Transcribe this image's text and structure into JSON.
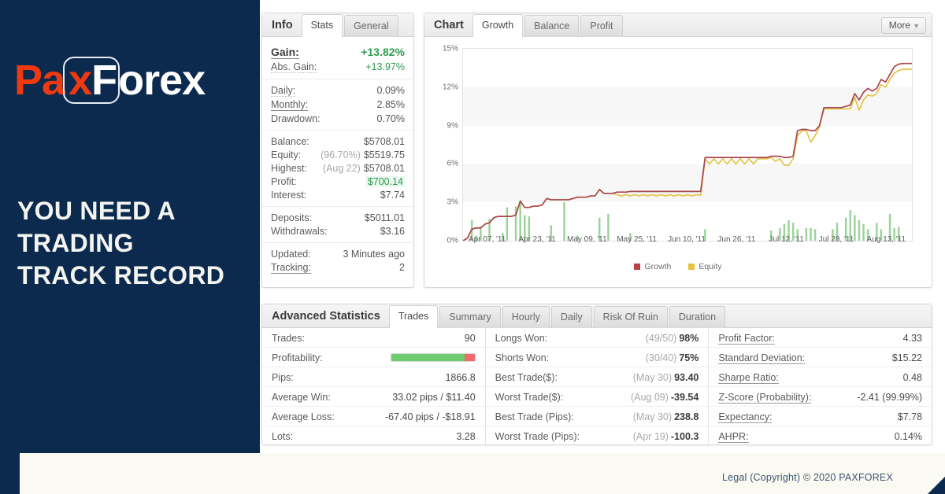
{
  "brand": {
    "part1": "Pa",
    "part2": "x",
    "part3": "F",
    "part4": "orex"
  },
  "headline": "YOU NEED A\nTRADING\nTRACK RECORD",
  "footer": {
    "legal": "Legal (Copyright) ©  2020 PAXFOREX"
  },
  "info_panel": {
    "tab_title": "Info",
    "tabs": [
      {
        "label": "Stats",
        "active": true
      },
      {
        "label": "General",
        "active": false
      }
    ],
    "groups": [
      [
        {
          "key": "Gain:",
          "value": "+13.82%",
          "style": "big",
          "keystyle": "und"
        },
        {
          "key": "Abs. Gain:",
          "value": "+13.97%",
          "style": "green",
          "keystyle": "dot"
        }
      ],
      [
        {
          "key": "Daily:",
          "value": "0.09%",
          "style": "",
          "keystyle": "dot"
        },
        {
          "key": "Monthly:",
          "value": "2.85%",
          "style": "",
          "keystyle": "und"
        },
        {
          "key": "Drawdown:",
          "value": "0.70%",
          "style": "",
          "keystyle": ""
        }
      ],
      [
        {
          "key": "Balance:",
          "value": "$5708.01",
          "style": "",
          "keystyle": ""
        },
        {
          "key": "Equity:",
          "sub": "(96.70%)",
          "value": "$5519.75",
          "style": "",
          "keystyle": ""
        },
        {
          "key": "Highest:",
          "sub": "(Aug 22)",
          "value": "$5708.01",
          "style": "",
          "keystyle": ""
        },
        {
          "key": "Profit:",
          "value": "$700.14",
          "style": "green-hl",
          "keystyle": ""
        },
        {
          "key": "Interest:",
          "value": "$7.74",
          "style": "",
          "keystyle": ""
        }
      ],
      [
        {
          "key": "Deposits:",
          "value": "$5011.01",
          "style": "",
          "keystyle": ""
        },
        {
          "key": "Withdrawals:",
          "value": "$3.16",
          "style": "",
          "keystyle": ""
        }
      ],
      [
        {
          "key": "Updated:",
          "value": "3 Minutes ago",
          "style": "",
          "keystyle": ""
        },
        {
          "key": "Tracking:",
          "value": "2",
          "style": "",
          "keystyle": "und"
        }
      ]
    ]
  },
  "chart_panel": {
    "tab_title": "Chart",
    "tabs": [
      {
        "label": "Growth",
        "active": true
      },
      {
        "label": "Balance",
        "active": false
      },
      {
        "label": "Profit",
        "active": false
      }
    ],
    "more_label": "More",
    "more_caret": "▼"
  },
  "chart_data": {
    "type": "line",
    "title": "Growth",
    "xlabel": "",
    "ylabel": "",
    "ylim": [
      0,
      15
    ],
    "yticks": [
      0,
      3,
      6,
      9,
      12,
      15
    ],
    "ytick_labels": [
      "0%",
      "3%",
      "6%",
      "9%",
      "12%",
      "15%"
    ],
    "grid": true,
    "legend_position": "bottom",
    "xtick_labels": [
      "Apr 07, '11",
      "Apr 23, '11",
      "May 09, '11",
      "May 25, '11",
      "Jun 10, '11",
      "Jun 26, '11",
      "Jul 12, '11",
      "Jul 28, '11",
      "Aug 13, '11"
    ],
    "legend": [
      {
        "name": "Growth",
        "color": "#b4414a"
      },
      {
        "name": "Equity",
        "color": "#e8c33c"
      }
    ],
    "series": [
      {
        "name": "Growth",
        "color": "#a8474f",
        "values": [
          0.0,
          0.2,
          0.9,
          1.0,
          1.0,
          1.3,
          1.4,
          1.8,
          1.9,
          1.9,
          1.9,
          1.9,
          2.0,
          3.1,
          2.6,
          2.6,
          2.7,
          2.7,
          2.8,
          3.3,
          3.2,
          3.2,
          3.2,
          3.2,
          3.2,
          3.3,
          3.4,
          3.4,
          3.4,
          3.5,
          3.5,
          4.0,
          3.7,
          3.7,
          3.7,
          3.8,
          3.8,
          3.8,
          3.85,
          3.85,
          3.85,
          3.85,
          3.85,
          3.85,
          3.85,
          3.85,
          3.85,
          3.85,
          3.85,
          3.85,
          3.85,
          3.85,
          3.85,
          3.85,
          3.85,
          6.5,
          6.5,
          6.5,
          6.5,
          6.5,
          6.5,
          6.5,
          6.5,
          6.5,
          6.5,
          6.5,
          6.5,
          6.5,
          6.5,
          6.5,
          6.6,
          6.6,
          6.6,
          6.5,
          6.5,
          6.6,
          8.6,
          8.7,
          8.7,
          8.6,
          8.6,
          9.0,
          10.4,
          10.4,
          10.4,
          10.4,
          10.4,
          10.5,
          10.6,
          11.5,
          11.0,
          11.6,
          11.9,
          11.7,
          11.9,
          12.6,
          12.4,
          13.0,
          13.6,
          13.8,
          13.85,
          13.85,
          13.85
        ],
        "last_value": 13.82
      },
      {
        "name": "Equity",
        "color": "#e3c44a",
        "values": [
          0.0,
          0.2,
          0.9,
          1.0,
          1.0,
          1.3,
          1.4,
          1.8,
          1.9,
          1.9,
          1.9,
          1.9,
          2.0,
          3.1,
          2.6,
          2.6,
          2.7,
          2.7,
          2.8,
          3.3,
          3.2,
          3.2,
          3.2,
          3.2,
          3.2,
          3.3,
          3.4,
          3.4,
          3.4,
          3.5,
          3.5,
          4.0,
          3.7,
          3.7,
          3.7,
          3.6,
          3.5,
          3.6,
          3.5,
          3.6,
          3.5,
          3.6,
          3.5,
          3.6,
          3.5,
          3.6,
          3.5,
          3.6,
          3.5,
          3.6,
          3.5,
          3.6,
          3.5,
          3.6,
          3.55,
          6.4,
          6.0,
          6.4,
          6.0,
          6.4,
          6.0,
          6.4,
          6.0,
          6.4,
          6.0,
          6.4,
          6.0,
          6.4,
          6.4,
          6.4,
          6.5,
          6.2,
          6.4,
          5.9,
          5.9,
          6.4,
          8.2,
          8.6,
          8.6,
          7.7,
          8.2,
          8.9,
          10.3,
          10.3,
          10.3,
          10.3,
          10.3,
          10.3,
          10.3,
          11.2,
          10.2,
          11.0,
          11.4,
          11.3,
          11.5,
          12.2,
          12.0,
          12.6,
          13.1,
          13.3,
          13.4,
          13.4,
          13.4
        ],
        "last_value": 13.97
      }
    ],
    "bars": {
      "name": "Volume",
      "color": "#9bd49b",
      "values": [
        0,
        0,
        1.6,
        0.4,
        1.1,
        0,
        1.7,
        0,
        0,
        0.6,
        2.6,
        0,
        2.7,
        3.1,
        2.0,
        1.9,
        0,
        0,
        0,
        0,
        1.2,
        0,
        0,
        3.0,
        0,
        0,
        0.4,
        0,
        0,
        0,
        0,
        1.8,
        0,
        2.1,
        0,
        0,
        0,
        0,
        0.6,
        0,
        0,
        0,
        0,
        0,
        0,
        0,
        0,
        0,
        0,
        0,
        0,
        0,
        0,
        0,
        0,
        0.9,
        0,
        0,
        0,
        0,
        0,
        0,
        0,
        0,
        0,
        0,
        0,
        0,
        0,
        0,
        0.8,
        0,
        1.0,
        1.3,
        1.6,
        1.4,
        0.9,
        0,
        1.0,
        1.0,
        0.9,
        0,
        0,
        0,
        0.9,
        1.4,
        0,
        1.8,
        2.4,
        2.0,
        1.6,
        1.3,
        0.9,
        0,
        1.4,
        0.9,
        0,
        2.1,
        1.0,
        1.1,
        0,
        0
      ]
    }
  },
  "stats_panel": {
    "tab_title": "Advanced Statistics",
    "tabs": [
      {
        "label": "Trades",
        "active": true
      },
      {
        "label": "Summary",
        "active": false
      },
      {
        "label": "Hourly",
        "active": false
      },
      {
        "label": "Daily",
        "active": false
      },
      {
        "label": "Risk Of Ruin",
        "active": false
      },
      {
        "label": "Duration",
        "active": false
      }
    ],
    "columns": [
      [
        {
          "key": "Trades:",
          "value": "90",
          "type": "text",
          "keystyle": ""
        },
        {
          "key": "Profitability:",
          "type": "bar",
          "win_pct": 88,
          "loss_pct": 12,
          "win_color": "#6ecb6e",
          "loss_color": "#ef6b6b",
          "keystyle": ""
        },
        {
          "key": "Pips:",
          "value": "1866.8",
          "type": "text",
          "keystyle": ""
        },
        {
          "key": "Average Win:",
          "value": "33.02 pips / $11.40",
          "type": "text",
          "keystyle": ""
        },
        {
          "key": "Average Loss:",
          "value": "-67.40 pips / -$18.91",
          "type": "text",
          "keystyle": ""
        },
        {
          "key": "Lots:",
          "value": "3.28",
          "type": "text",
          "keystyle": ""
        }
      ],
      [
        {
          "key": "Longs Won:",
          "muted": "(49/50)",
          "value": "98%",
          "type": "bold",
          "keystyle": ""
        },
        {
          "key": "Shorts Won:",
          "muted": "(30/40)",
          "value": "75%",
          "type": "bold",
          "keystyle": ""
        },
        {
          "key": "Best Trade($):",
          "muted": "(May 30)",
          "value": "93.40",
          "type": "bold",
          "keystyle": ""
        },
        {
          "key": "Worst Trade($):",
          "muted": "(Aug 09)",
          "value": "-39.54",
          "type": "bold",
          "keystyle": ""
        },
        {
          "key": "Best Trade (Pips):",
          "muted": "(May 30)",
          "value": "238.8",
          "type": "bold",
          "keystyle": ""
        },
        {
          "key": "Worst Trade (Pips):",
          "muted": "(Apr 19)",
          "value": "-100.3",
          "type": "bold",
          "keystyle": ""
        }
      ],
      [
        {
          "key": "Profit Factor:",
          "value": "4.33",
          "type": "text",
          "keystyle": "und"
        },
        {
          "key": "Standard Deviation:",
          "value": "$15.22",
          "type": "text",
          "keystyle": "und"
        },
        {
          "key": "Sharpe Ratio:",
          "value": "0.48",
          "type": "text",
          "keystyle": "und"
        },
        {
          "key": "Z-Score (Probability):",
          "value": "-2.41 (99.99%)",
          "type": "text",
          "keystyle": "und"
        },
        {
          "key": "Expectancy:",
          "value": "$7.78",
          "type": "text",
          "keystyle": "und"
        },
        {
          "key": "AHPR:",
          "value": "0.14%",
          "type": "text",
          "keystyle": "und"
        }
      ]
    ]
  }
}
